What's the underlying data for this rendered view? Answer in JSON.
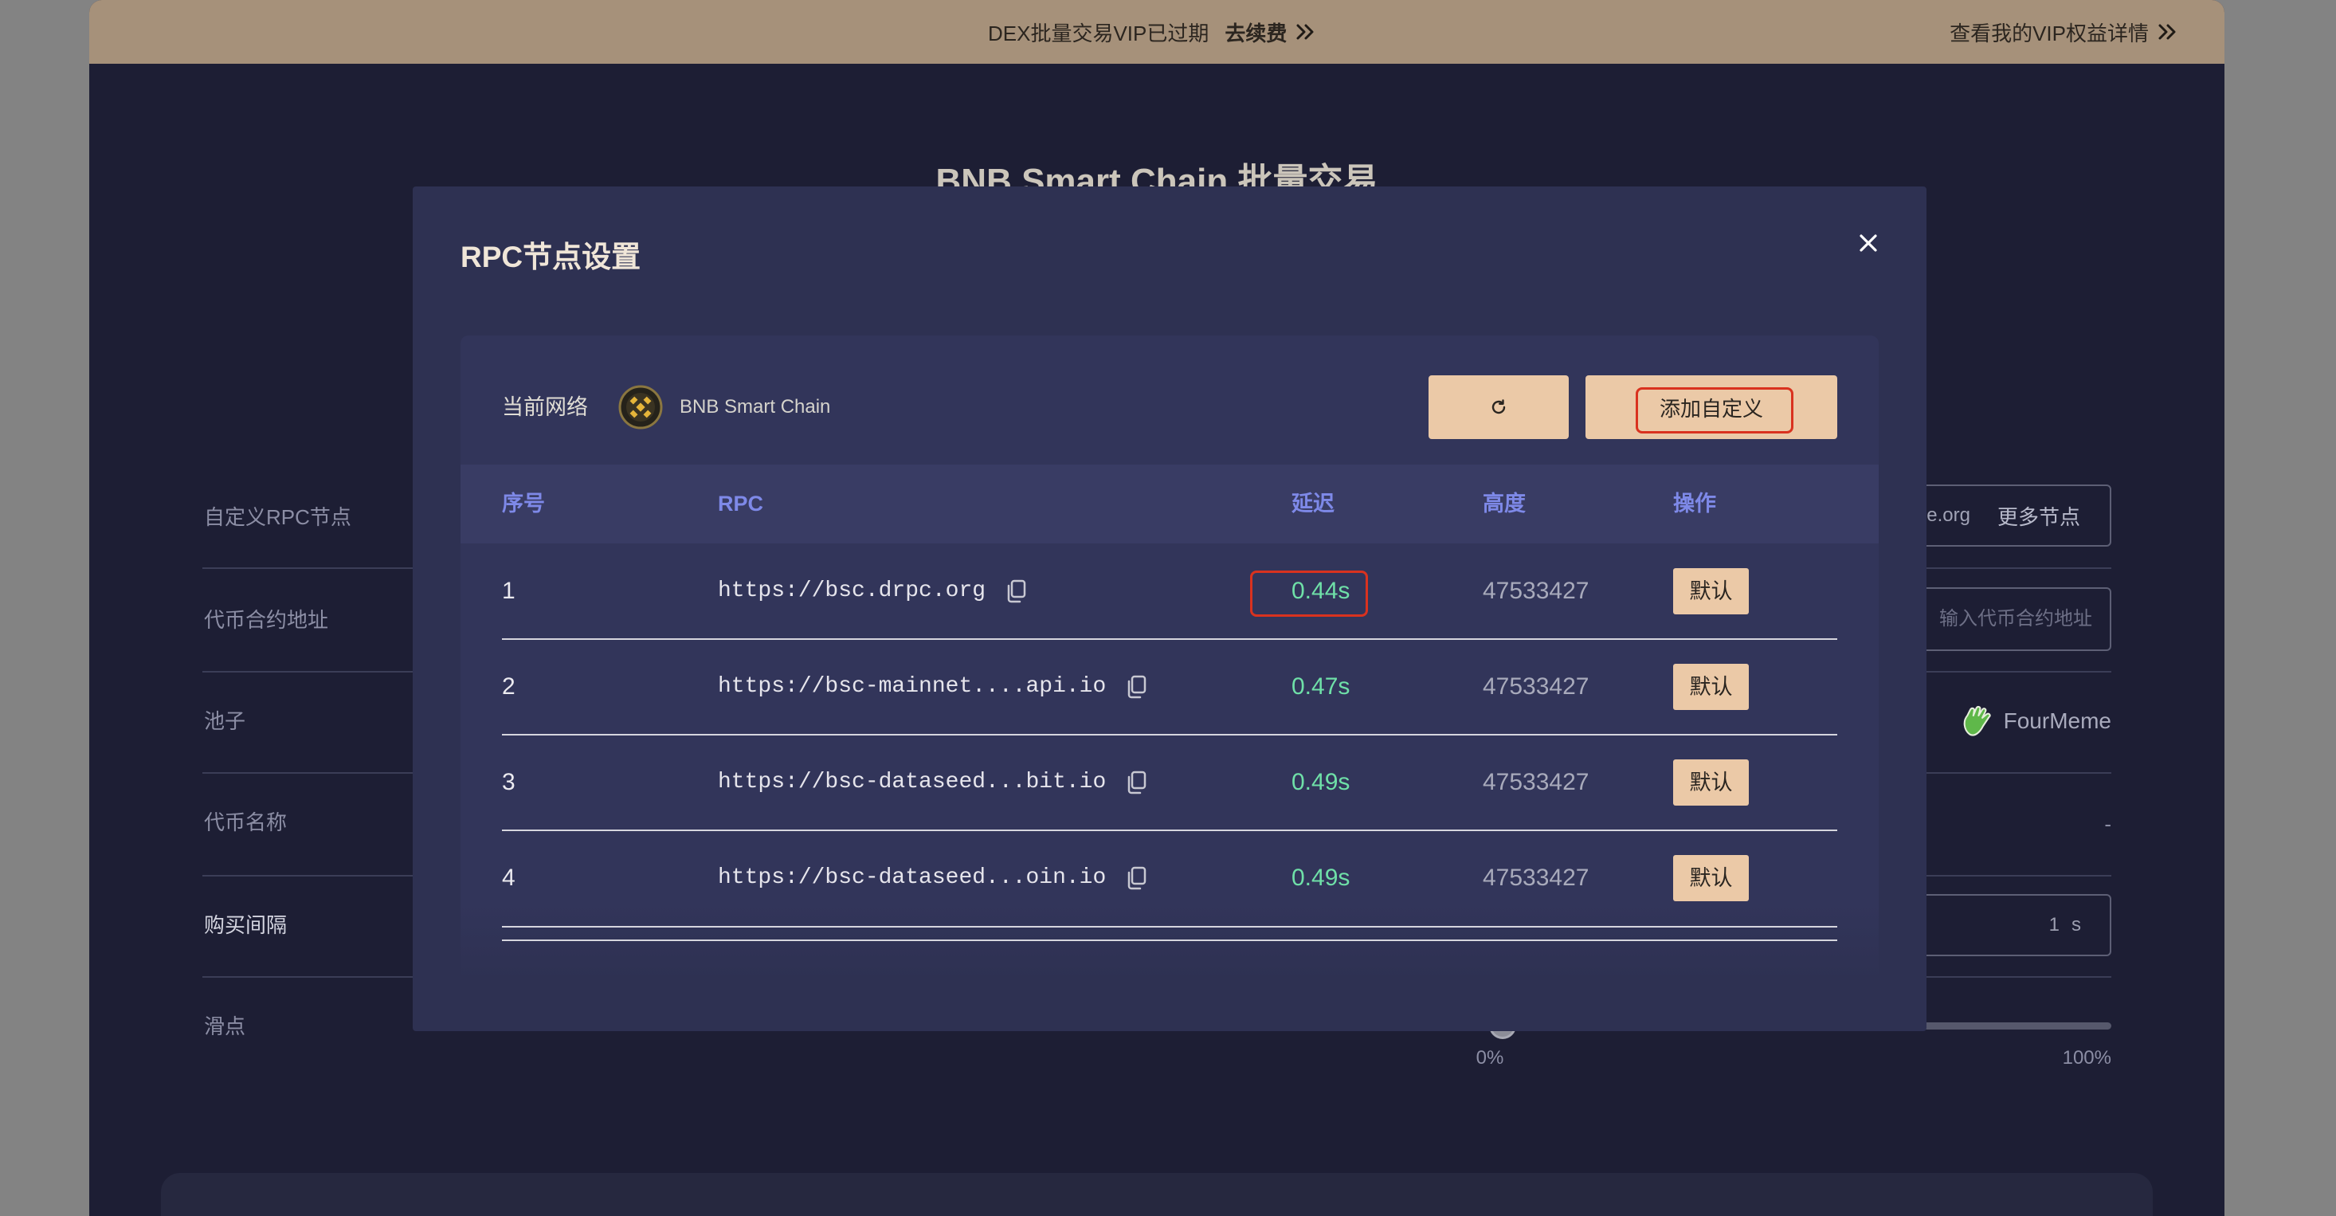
{
  "banner": {
    "vip_status": "DEX批量交易VIP已过期",
    "renew_label": "去续费",
    "vip_details_label": "查看我的VIP权益详情"
  },
  "page": {
    "title": "BNB Smart Chain 批量交易",
    "form": {
      "rpc_label": "自定义RPC节点",
      "rpc_value": "e.org",
      "more_nodes_label": "更多节点",
      "token_address_label": "代币合约地址",
      "token_address_placeholder": "输入代币合约地址",
      "pool_label": "池子",
      "pool_value": "FourMeme",
      "token_name_label": "代币名称",
      "token_name_value": "-",
      "interval_label": "购买间隔",
      "interval_value": "1",
      "interval_unit": "s",
      "slippage_label": "滑点",
      "slippage_min": "0%",
      "slippage_max": "100%",
      "slippage_level": 0.02
    }
  },
  "modal": {
    "title": "RPC节点设置",
    "network_label": "当前网络",
    "network_name": "BNB Smart Chain",
    "add_custom_label": "添加自定义",
    "columns": {
      "index": "序号",
      "rpc": "RPC",
      "latency": "延迟",
      "height": "高度",
      "action": "操作"
    },
    "rows": [
      {
        "index": "1",
        "rpc": "https://bsc.drpc.org",
        "latency": "0.44s",
        "height": "47533427",
        "action": "默认"
      },
      {
        "index": "2",
        "rpc": "https://bsc-mainnet....api.io",
        "latency": "0.47s",
        "height": "47533427",
        "action": "默认"
      },
      {
        "index": "3",
        "rpc": "https://bsc-dataseed...bit.io",
        "latency": "0.49s",
        "height": "47533427",
        "action": "默认"
      },
      {
        "index": "4",
        "rpc": "https://bsc-dataseed...oin.io",
        "latency": "0.49s",
        "height": "47533427",
        "action": "默认"
      }
    ]
  },
  "icons": {
    "banner_link": "double-chevron-right-icon",
    "close": "close-icon",
    "refresh": "refresh-icon",
    "copy": "copy-icon",
    "network": "bnb-chain-icon",
    "pool": "fourmeme-logo"
  },
  "theme": {
    "accent": "#ebc9a7",
    "latency": "#6fe0a8",
    "table_header_text": "#7e89e8",
    "highlight": "#d9321f",
    "banner": "#a6917a"
  }
}
